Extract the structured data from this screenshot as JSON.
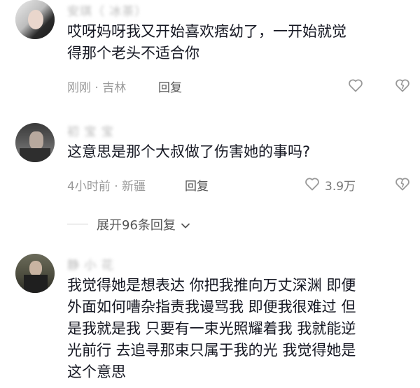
{
  "comments": [
    {
      "username": "安琪（ 冰茶）",
      "text": "哎呀妈呀我又开始喜欢痞幼了，一开始就觉\n得那个老头不适合你",
      "meta": "刚刚 · 吉林",
      "reply_label": "回复",
      "like_count": ""
    },
    {
      "username": "初 宝 宝",
      "text": "这意思是那个大叔做了伤害她的事吗?",
      "meta": "4小时前 · 新疆",
      "reply_label": "回复",
      "like_count": "3.9万"
    },
    {
      "username": "静 小 花",
      "text": "我觉得她是想表达 你把我推向万丈深渊 即便\n外面如何嘈杂指责我谩骂我 即便我很难过 但\n是我就是我 只要有一束光照耀着我 我就能逆\n光前行 去追寻那束只属于我的光 我觉得她是\n这个意思"
    }
  ],
  "expand_replies": {
    "label": "展开96条回复",
    "chevron": "chevron-down-icon"
  },
  "icons": {
    "like": "heart-outline-icon",
    "dislike": "broken-heart-icon"
  },
  "colors": {
    "text": "#161823",
    "meta": "#9a9a9a",
    "icon": "#9a9a9a"
  }
}
